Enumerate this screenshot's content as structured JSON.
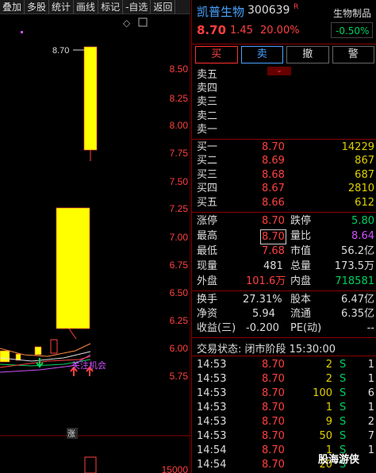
{
  "toolbar": {
    "items": [
      "叠加",
      "多股",
      "统计",
      "画线",
      "标记",
      "-自选",
      "返回"
    ]
  },
  "chart": {
    "price_labels": [
      "8.50",
      "8.25",
      "8.00",
      "7.75",
      "7.50",
      "7.25",
      "7.00",
      "6.75",
      "6.50",
      "6.25",
      "6.00",
      "5.75"
    ],
    "volume_label": "15000",
    "high_marker": "8.70",
    "annotation": "关注机会",
    "zhang_badge": "涨",
    "diamond": "◇",
    "expand": "⊡"
  },
  "stock": {
    "name": "凯普生物",
    "code": "300639",
    "flag": "R",
    "price": "8.70",
    "change": "1.45",
    "pct": "20.00%",
    "sector": "生物制品",
    "sector_pct": "-0.50%"
  },
  "buttons": {
    "buy": "买",
    "sell": "卖",
    "cancel": "撤",
    "alert": "警"
  },
  "collapse": "⌄",
  "asks": [
    {
      "label": "卖五",
      "price": "",
      "vol": ""
    },
    {
      "label": "卖四",
      "price": "",
      "vol": ""
    },
    {
      "label": "卖三",
      "price": "",
      "vol": ""
    },
    {
      "label": "卖二",
      "price": "",
      "vol": ""
    },
    {
      "label": "卖一",
      "price": "",
      "vol": ""
    }
  ],
  "bids": [
    {
      "label": "买一",
      "price": "8.70",
      "vol": "14229"
    },
    {
      "label": "买二",
      "price": "8.69",
      "vol": "867"
    },
    {
      "label": "买三",
      "price": "8.68",
      "vol": "687"
    },
    {
      "label": "买四",
      "price": "8.67",
      "vol": "2810"
    },
    {
      "label": "买五",
      "price": "8.66",
      "vol": "612"
    }
  ],
  "stats": {
    "zt_label": "涨停",
    "zt": "8.70",
    "dt_label": "跌停",
    "dt": "5.80",
    "high_label": "最高",
    "high": "8.70",
    "lb_label": "量比",
    "lb": "8.64",
    "low_label": "最低",
    "low": "7.68",
    "mv_label": "市值",
    "mv": "56.2亿",
    "cur_label": "现量",
    "cur": "481",
    "tv_label": "总量",
    "tv": "173.5万",
    "out_label": "外盘",
    "out": "101.6万",
    "in_label": "内盘",
    "in": "718581",
    "turn_label": "换手",
    "turn": "27.31%",
    "eq_label": "股本",
    "eq": "6.47亿",
    "nav_label": "净资",
    "nav": "5.94",
    "float_label": "流通",
    "float": "6.35亿",
    "eps_label": "收益(三)",
    "eps": "-0.200",
    "pe_label": "PE(动)",
    "pe": "--"
  },
  "status": "交易状态: 闭市阶段 15:30:00",
  "ticks": [
    {
      "time": "14:53",
      "price": "8.70",
      "vol": "2",
      "side": "S",
      "n": "1"
    },
    {
      "time": "14:53",
      "price": "8.70",
      "vol": "2",
      "side": "S",
      "n": "1"
    },
    {
      "time": "14:53",
      "price": "8.70",
      "vol": "100",
      "side": "S",
      "n": "6"
    },
    {
      "time": "14:53",
      "price": "8.70",
      "vol": "1",
      "side": "S",
      "n": "1"
    },
    {
      "time": "14:53",
      "price": "8.70",
      "vol": "9",
      "side": "S",
      "n": "2"
    },
    {
      "time": "14:53",
      "price": "8.70",
      "vol": "50",
      "side": "S",
      "n": "7"
    },
    {
      "time": "14:54",
      "price": "8.70",
      "vol": "1",
      "side": "S",
      "n": "1"
    },
    {
      "time": "14:54",
      "price": "8.70",
      "vol": "20",
      "side": "S",
      "n": ""
    }
  ],
  "watermark": "股海游侠",
  "colors": {
    "up": "#ff4040",
    "down": "#00d060",
    "accent": "#4aa3ff",
    "candle": "#ffff00"
  }
}
